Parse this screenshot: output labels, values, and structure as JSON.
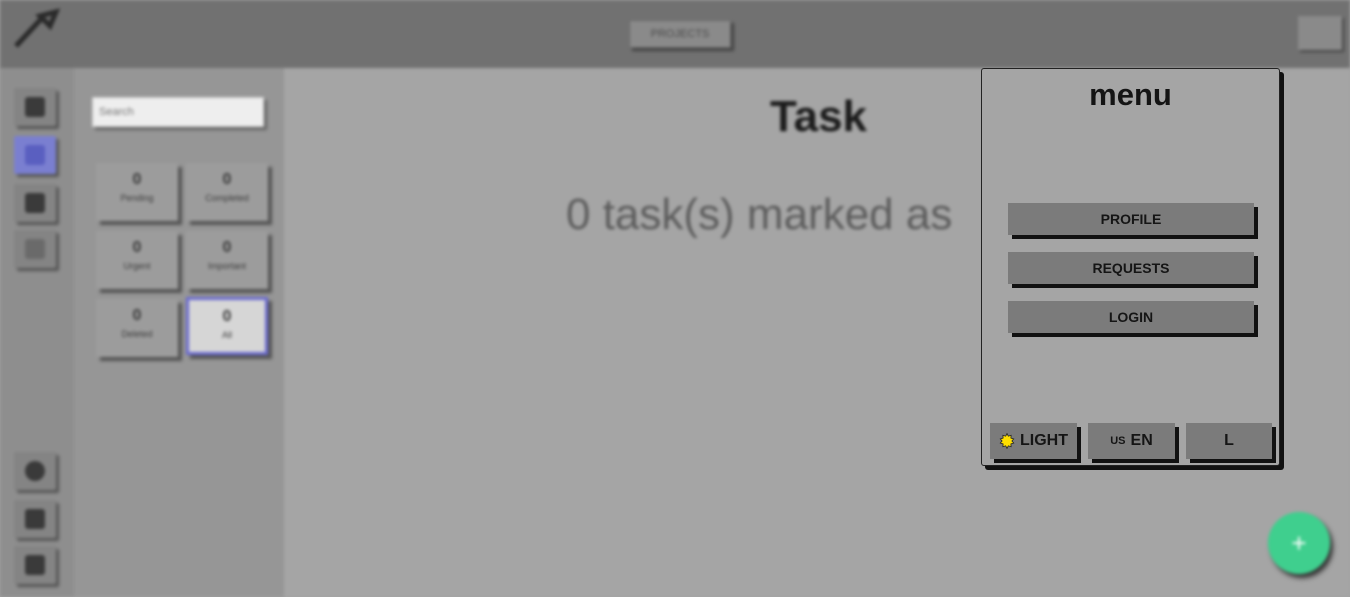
{
  "header": {
    "project_label": "PROJECTS"
  },
  "sidebar": {
    "search_placeholder": "Search"
  },
  "filters": [
    {
      "count": "0",
      "label": "Pending"
    },
    {
      "count": "0",
      "label": "Completed"
    },
    {
      "count": "0",
      "label": "Urgent"
    },
    {
      "count": "0",
      "label": "Important"
    },
    {
      "count": "0",
      "label": "Deleted"
    },
    {
      "count": "0",
      "label": "All"
    }
  ],
  "main": {
    "title": "Task",
    "message": "0 task(s) marked as"
  },
  "fab": {
    "label": "+"
  },
  "menu": {
    "title": "menu",
    "items": [
      {
        "label": "PROFILE"
      },
      {
        "label": "REQUESTS"
      },
      {
        "label": "LOGIN"
      }
    ],
    "theme_label": "LIGHT",
    "language_flag": "US",
    "language_label": "EN",
    "size_label": "L"
  },
  "colors": {
    "accent": "#6a6ad0",
    "fab": "#3fcf8e",
    "sun": "#ffe000"
  },
  "icons": [
    "logo-icon",
    "home-icon",
    "tasks-icon",
    "document-icon",
    "link-icon",
    "github-icon",
    "trash-icon",
    "settings-icon",
    "sun-icon"
  ]
}
